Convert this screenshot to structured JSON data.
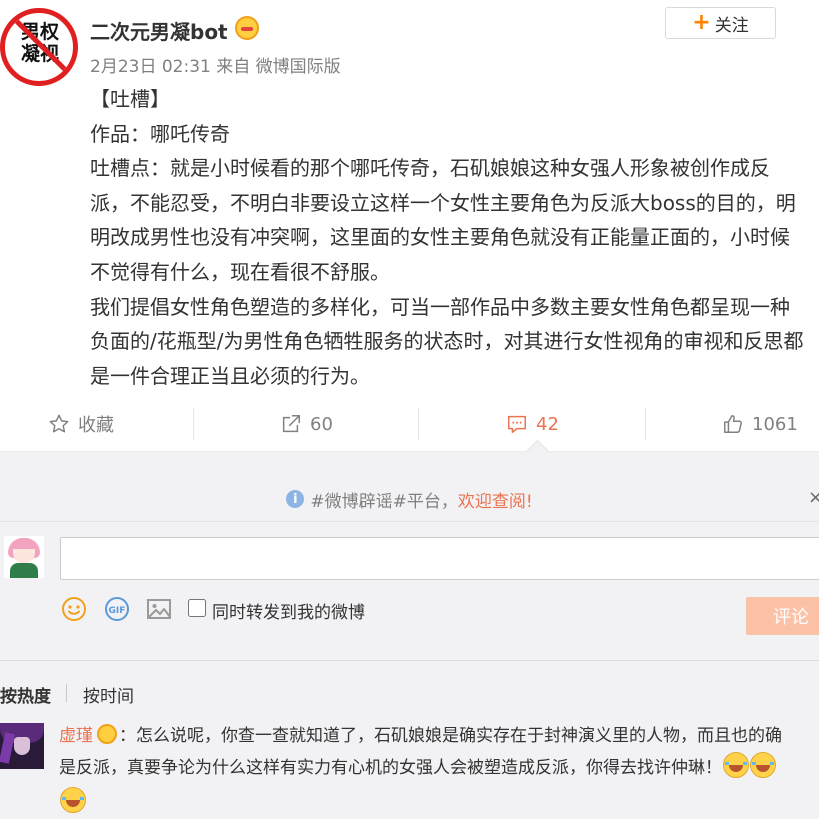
{
  "author": {
    "avatar_text": "男权\n凝视",
    "name": "二次元男凝bot",
    "meta": "2月23日 02:31 来自 微博国际版",
    "follow_label": "关注"
  },
  "post": {
    "lines": [
      "【吐槽】",
      "作品：哪吒传奇",
      "吐槽点：就是小时候看的那个哪吒传奇，石矶娘娘这种女强人形象被创作成反",
      "派，不能忍受，不明白非要设立这样一个女性主要角色为反派大boss的目的，明",
      "明改成男性也没有冲突啊，这里面的女性主要角色就没有正能量正面的，小时候",
      "不觉得有什么，现在看很不舒服。",
      "我们提倡女性角色塑造的多样化，可当一部作品中多数主要女性角色都呈现一种",
      "负面的/花瓶型/为男性角色牺牲服务的状态时，对其进行女性视角的审视和反思都",
      "是一件合理正当且必须的行为。"
    ]
  },
  "actions": {
    "favorite_label": "收藏",
    "repost_count": "60",
    "comment_count": "42",
    "like_count": "1061"
  },
  "comments": {
    "notice_prefix": "#微博辟谣#平台，",
    "notice_link": "欢迎查阅!",
    "notice_close": "×",
    "input_placeholder": "",
    "repost_label": "同时转发到我的微博",
    "submit_label": "评论",
    "sort_hot": "按热度",
    "sort_time": "按时间",
    "items": [
      {
        "user": "虚瑾",
        "text_line1": "：怎么说呢，你查一查就知道了，石矶娘娘是确实存在于封神演义里的人物，而且也的确",
        "text_line2": "是反派，真要争论为什么这样有实力有心机的女强人会被塑造成反派，你得去找许仲琳！"
      }
    ]
  },
  "colors": {
    "accent": "#eb7350",
    "follow_plus": "#ff8200",
    "avatar_ring": "#e02020",
    "comment_bg": "#f2f2f5",
    "submit_disabled": "#fbc2a7"
  },
  "icons": {
    "favorite": "star-icon",
    "repost": "share-icon",
    "comment": "comment-icon",
    "like": "thumbs-up-icon",
    "notice": "info-icon",
    "emoji": "smile-icon",
    "gif": "gif-icon",
    "image": "image-icon"
  }
}
